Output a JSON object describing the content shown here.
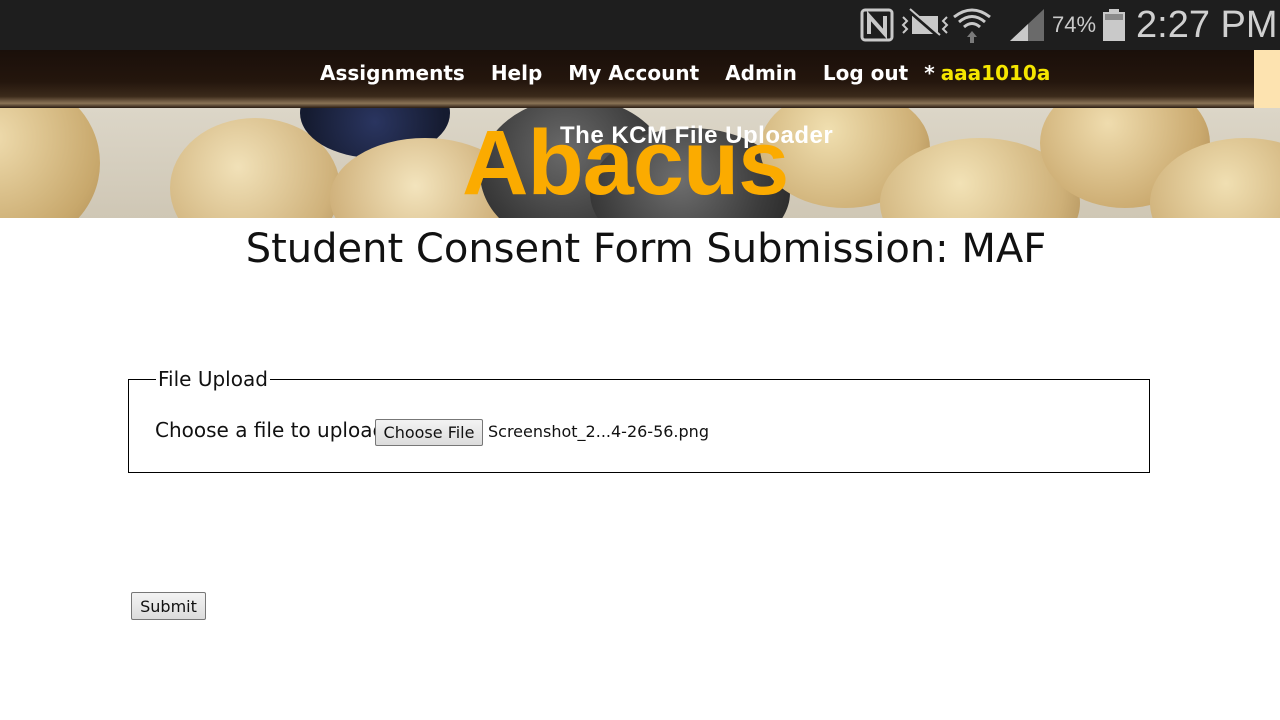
{
  "status_bar": {
    "battery_percent": "74%",
    "time": "2:27 PM",
    "icons": [
      "nfc-icon",
      "vibrate-mute-icon",
      "wifi-icon",
      "signal-icon",
      "battery-icon"
    ]
  },
  "nav": {
    "items": [
      {
        "label": "Assignments"
      },
      {
        "label": "Help"
      },
      {
        "label": "My Account"
      },
      {
        "label": "Admin"
      },
      {
        "label": "Log out"
      }
    ],
    "user_prefix": "*",
    "user": "aaa1010a"
  },
  "banner": {
    "subtitle": "The KCM File Uploader",
    "title": "Abacus"
  },
  "page": {
    "title": "Student Consent Form Submission: MAF"
  },
  "upload": {
    "legend": "File Upload",
    "label": "Choose a file to upload:",
    "button_label": "Choose File",
    "file_name": "Screenshot_2...4-26-56.png"
  },
  "form": {
    "submit_label": "Submit"
  },
  "colors": {
    "accent": "#fbab00",
    "user_highlight": "#f5e600",
    "nav_background": "#1a0f0a",
    "status_bar": "#1e1e1e"
  }
}
